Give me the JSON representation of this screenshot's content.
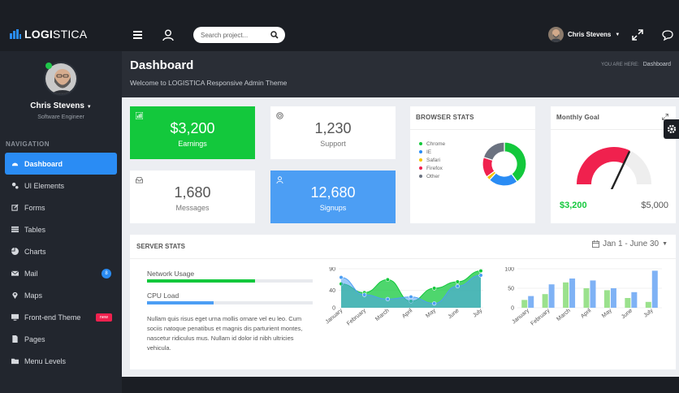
{
  "brand": {
    "name_bold": "LOGI",
    "name_light": "STICA"
  },
  "topbar": {
    "search_placeholder": "Search project...",
    "user_name": "Chris Stevens",
    "icons": [
      "hamburger-icon",
      "user-icon",
      "search-icon",
      "expand-icon",
      "chat-icon"
    ]
  },
  "sidebar": {
    "profile_name": "Chris Stevens",
    "profile_role": "Software Engineer",
    "nav_title": "NAVIGATION",
    "items": [
      {
        "label": "Dashboard",
        "icon": "dashboard-icon",
        "active": true
      },
      {
        "label": "UI Elements",
        "icon": "ui-elements-icon"
      },
      {
        "label": "Forms",
        "icon": "forms-icon"
      },
      {
        "label": "Tables",
        "icon": "tables-icon"
      },
      {
        "label": "Charts",
        "icon": "charts-icon"
      },
      {
        "label": "Mail",
        "icon": "mail-icon",
        "badge": "8"
      },
      {
        "label": "Maps",
        "icon": "maps-icon"
      },
      {
        "label": "Front-end Theme",
        "icon": "monitor-icon",
        "tag": "new"
      },
      {
        "label": "Pages",
        "icon": "pages-icon"
      },
      {
        "label": "Menu Levels",
        "icon": "folder-icon"
      }
    ]
  },
  "header": {
    "title": "Dashboard",
    "subtitle": "Welcome to LOGISTICA Responsive Admin Theme",
    "breadcrumb_prefix": "YOU ARE HERE:",
    "breadcrumb_current": "Dashboard"
  },
  "stats": [
    {
      "value": "$3,200",
      "label": "Earnings",
      "icon": "bar-chart-icon",
      "color": "#13c83c"
    },
    {
      "value": "1,230",
      "label": "Support",
      "icon": "support-icon"
    },
    {
      "value": "1,680",
      "label": "Messages",
      "icon": "inbox-icon"
    },
    {
      "value": "12,680",
      "label": "Signups",
      "icon": "user-icon",
      "color": "#4c9ef4"
    }
  ],
  "browser_stats": {
    "title": "BROWSER STATS",
    "legend": [
      {
        "label": "Chrome",
        "color": "#13c83c"
      },
      {
        "label": "IE",
        "color": "#2a8cf4"
      },
      {
        "label": "Safari",
        "color": "#f5c400"
      },
      {
        "label": "Firefox",
        "color": "#f0214e"
      },
      {
        "label": "Other",
        "color": "#6b7280"
      }
    ]
  },
  "monthly_goal": {
    "title": "Monthly Goal",
    "current": "$3,200",
    "target": "$5,000",
    "fraction": 0.64
  },
  "server_stats": {
    "title": "SERVER STATS",
    "date_range": "Jan 1 - June 30",
    "network_label": "Network Usage",
    "network_pct": 65,
    "cpu_label": "CPU Load",
    "cpu_pct": 40,
    "description": "Nullam quis risus eget urna mollis ornare vel eu leo. Cum sociis natoque penatibus et magnis dis parturient montes, nascetur ridiculus mus. Nullam id dolor id nibh ultricies vehicula."
  },
  "chart_data": [
    {
      "type": "pie",
      "categories": [
        "Chrome",
        "IE",
        "Safari",
        "Firefox",
        "Other"
      ],
      "values": [
        40,
        22,
        3,
        15,
        20
      ],
      "colors": [
        "#13c83c",
        "#2a8cf4",
        "#f5c400",
        "#f0214e",
        "#6b7280"
      ]
    },
    {
      "type": "area",
      "categories": [
        "January",
        "February",
        "March",
        "April",
        "May",
        "June",
        "July"
      ],
      "yticks": [
        0,
        40,
        90
      ],
      "ylim": [
        0,
        90
      ],
      "series": [
        {
          "values": [
            55,
            35,
            65,
            15,
            45,
            60,
            85
          ],
          "color": "#13c83c"
        },
        {
          "values": [
            70,
            30,
            20,
            25,
            10,
            50,
            75
          ],
          "color": "#4c9ef4"
        }
      ]
    },
    {
      "type": "bar",
      "categories": [
        "January",
        "February",
        "March",
        "April",
        "May",
        "June",
        "July"
      ],
      "yticks": [
        0,
        50,
        100
      ],
      "ylim": [
        0,
        100
      ],
      "series": [
        {
          "values": [
            20,
            35,
            65,
            50,
            45,
            25,
            15
          ],
          "color": "#9be18d"
        },
        {
          "values": [
            30,
            60,
            75,
            70,
            50,
            40,
            95
          ],
          "color": "#7fb2f5"
        }
      ]
    }
  ]
}
